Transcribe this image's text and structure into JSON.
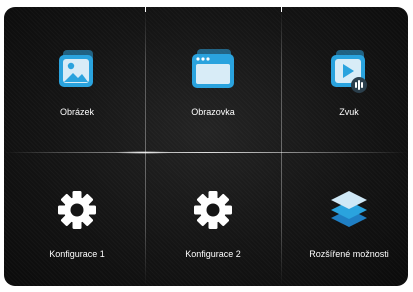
{
  "menu": {
    "items": [
      {
        "label": "Obrázek",
        "icon": "image-icon"
      },
      {
        "label": "Obrazovka",
        "icon": "screen-window-icon"
      },
      {
        "label": "Zvuk",
        "icon": "audio-play-icon"
      },
      {
        "label": "Konfigurace 1",
        "icon": "gear-icon"
      },
      {
        "label": "Konfigurace 2",
        "icon": "gear-icon"
      },
      {
        "label": "Rozšířené možnosti",
        "icon": "layers-icon"
      }
    ]
  },
  "colors": {
    "background": "#111111",
    "icon_blue": "#2aa3de",
    "icon_light": "#d8ecf7",
    "gear": "#ffffff",
    "label": "#ffffff"
  }
}
